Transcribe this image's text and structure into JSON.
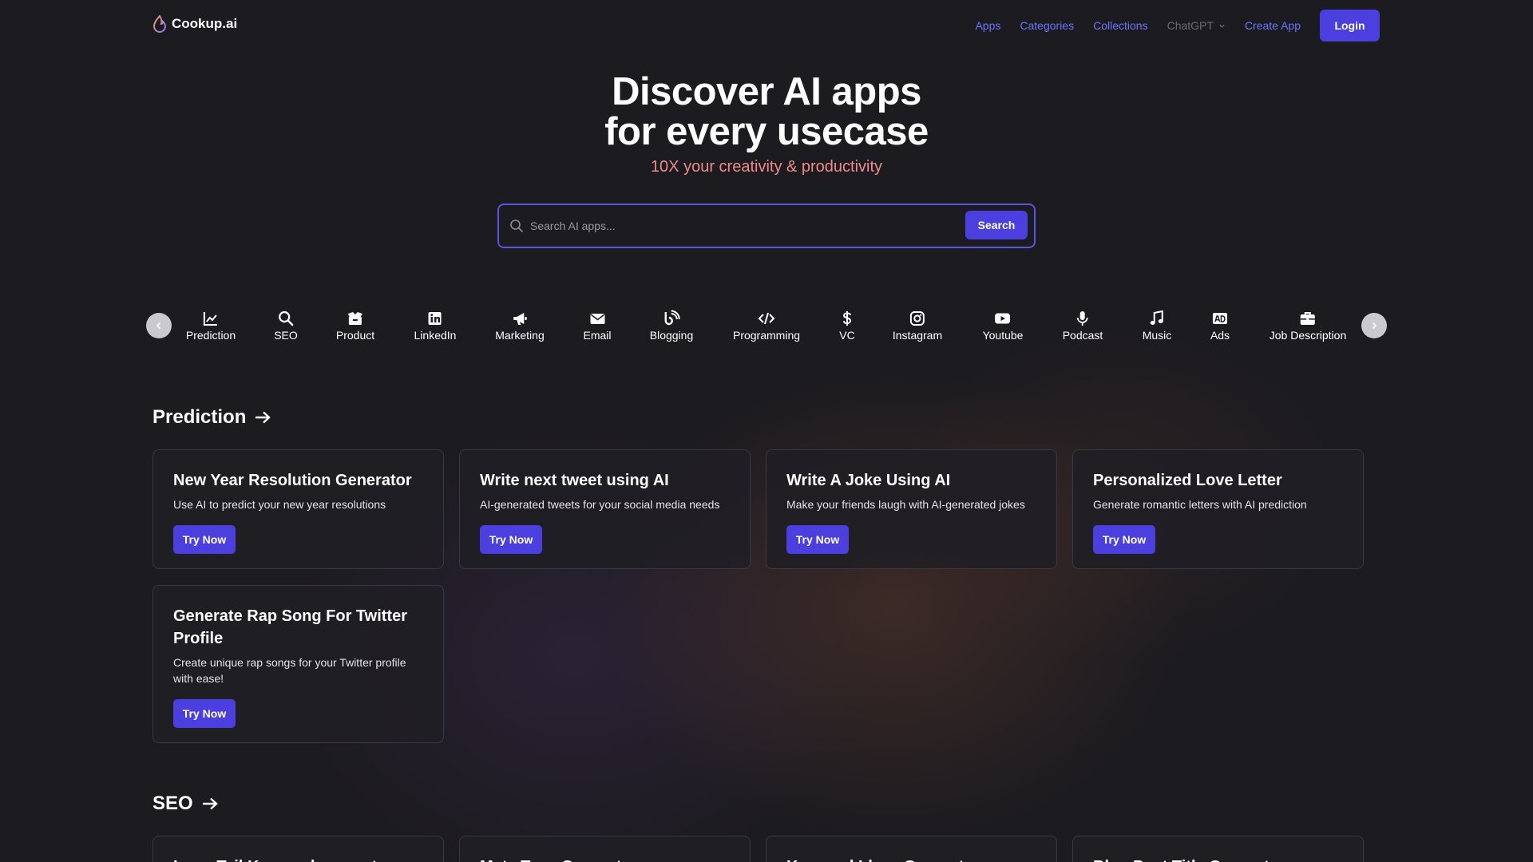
{
  "nav": {
    "logo_text": "Cookup.ai",
    "links": [
      "Apps",
      "Categories",
      "Collections"
    ],
    "chatgpt": "ChatGPT",
    "create_app": "Create App",
    "login": "Login"
  },
  "hero": {
    "title_line1": "Discover AI apps",
    "title_line2": "for every usecase",
    "subtitle": "10X your creativity & productivity"
  },
  "search": {
    "placeholder": "Search AI apps...",
    "button": "Search"
  },
  "categories": [
    {
      "label": "Prediction",
      "icon": "chart-line-icon"
    },
    {
      "label": "SEO",
      "icon": "search-icon"
    },
    {
      "label": "Product",
      "icon": "box-icon"
    },
    {
      "label": "LinkedIn",
      "icon": "linkedin-icon"
    },
    {
      "label": "Marketing",
      "icon": "megaphone-icon"
    },
    {
      "label": "Email",
      "icon": "envelope-icon"
    },
    {
      "label": "Blogging",
      "icon": "blog-icon"
    },
    {
      "label": "Programming",
      "icon": "code-icon"
    },
    {
      "label": "VC",
      "icon": "dollar-icon"
    },
    {
      "label": "Instagram",
      "icon": "instagram-icon"
    },
    {
      "label": "Youtube",
      "icon": "youtube-icon"
    },
    {
      "label": "Podcast",
      "icon": "microphone-icon"
    },
    {
      "label": "Music",
      "icon": "music-note-icon"
    },
    {
      "label": "Ads",
      "icon": "ad-icon"
    },
    {
      "label": "Job Description",
      "icon": "briefcase-icon"
    }
  ],
  "sections": [
    {
      "title": "Prediction",
      "cards": [
        {
          "title": "New Year Resolution Generator",
          "desc": "Use AI to predict your new year resolutions",
          "cta": "Try Now"
        },
        {
          "title": "Write next tweet using AI",
          "desc": "AI-generated tweets for your social media needs",
          "cta": "Try Now"
        },
        {
          "title": "Write A Joke Using AI",
          "desc": "Make your friends laugh with AI-generated jokes",
          "cta": "Try Now"
        },
        {
          "title": "Personalized Love Letter",
          "desc": "Generate romantic letters with AI prediction",
          "cta": "Try Now"
        },
        {
          "title": "Generate Rap Song For Twitter Profile",
          "desc": "Create unique rap songs for your Twitter profile with ease!",
          "cta": "Try Now"
        }
      ]
    },
    {
      "title": "SEO",
      "cards": [
        {
          "title": "Long Tail Keyword generator"
        },
        {
          "title": "Meta Tags Generator"
        },
        {
          "title": "Keyword Ideas Generator"
        },
        {
          "title": "Blog Post Title Generator"
        }
      ]
    }
  ],
  "colors": {
    "accent": "#4b3fe0",
    "link": "#6a74ff",
    "subtitle": "#f08a8a",
    "background": "#1c1b20"
  }
}
